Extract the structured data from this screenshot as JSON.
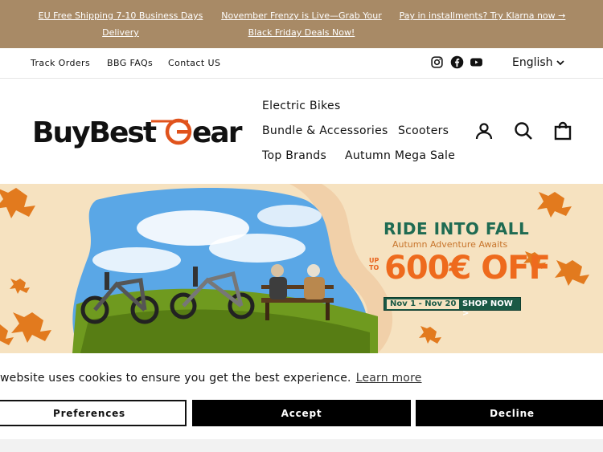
{
  "announcement": {
    "item1": "EU Free Shipping 7-10 Business Days Delivery",
    "item2": "November Frenzy is Live—Grab Your Black Friday Deals Now!",
    "item3": "Pay in installments? Try Klarna now →"
  },
  "utility": {
    "links": [
      "Track Orders",
      "BBG FAQs",
      "Contact US"
    ],
    "social": [
      "instagram-icon",
      "facebook-icon",
      "youtube-icon"
    ],
    "language": "English"
  },
  "header": {
    "logo_text": "BuyBestGear",
    "nav": [
      "Electric Bikes",
      "Bundle & Accessories",
      "Scooters",
      "Top Brands",
      "Autumn Mega Sale"
    ],
    "icons": [
      "account-icon",
      "search-icon",
      "cart-icon"
    ]
  },
  "hero": {
    "title": "RIDE INTO FALL",
    "subtitle": "Autumn Adventure Awaits",
    "upto": "UP TO",
    "discount": "600€ OFF",
    "dates": "Nov 1 - Nov 20",
    "cta": "SHOP NOW >",
    "colors": {
      "title": "#1f6b52",
      "accent": "#ee6a1d",
      "background": "#f6e2c0"
    }
  },
  "cookie": {
    "message": "website uses cookies to ensure you get the best experience.",
    "learn_more": "Learn more",
    "preferences": "Preferences",
    "accept": "Accept",
    "decline": "Decline"
  },
  "colors": {
    "announcement_bg": "#a88a66",
    "logo_accent": "#e0531c"
  }
}
